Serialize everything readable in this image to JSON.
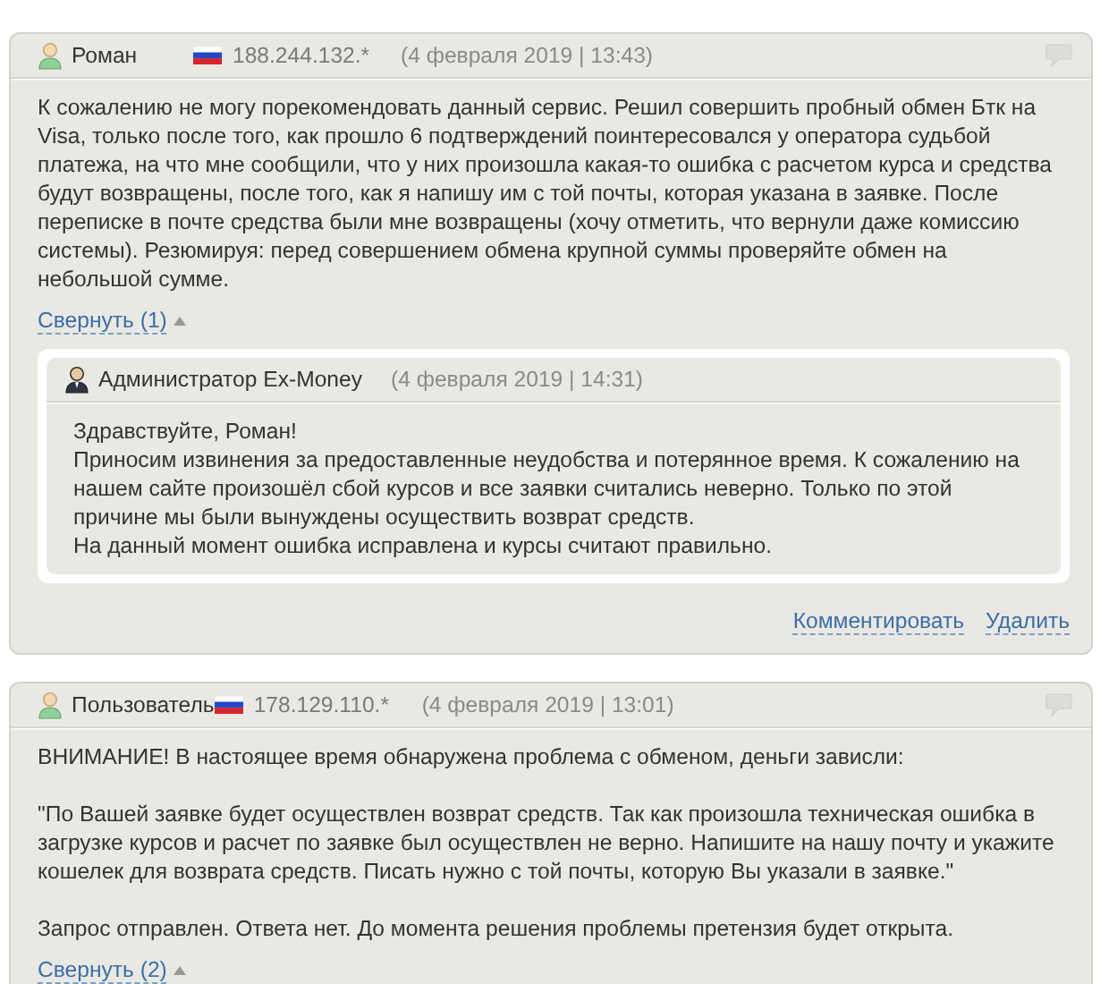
{
  "reviews": [
    {
      "author": "Роман",
      "ip": "188.244.132.*",
      "date": "(4 февраля 2019 | 13:43)",
      "paragraphs": [
        "К сожалению не могу порекомендовать данный сервис. Решил совершить пробный обмен Бтк на Visa, только после того, как прошло 6 подтверждений поинтересовался у оператора судьбой платежа, на что мне сообщили, что у них произошла какая-то ошибка с расчетом курса и средства будут возвращены, после того, как я напишу им с той почты, которая указана в заявке. После переписке в почте средства были мне возвращены (хочу отметить, что вернули даже комиссию системы). Резюмируя: перед совершением обмена крупной суммы проверяйте обмен на небольшой сумме."
      ],
      "collapse": "Свернуть (1)",
      "expanded": true,
      "replies": [
        {
          "author": "Администратор Ex-Money",
          "date": "(4 февраля 2019 | 14:31)",
          "lines": [
            "Здравствуйте, Роман!",
            "Приносим извинения за предоставленные неудобства и потерянное время. К сожалению на нашем сайте произошёл сбой курсов и все заявки считались неверно. Только по этой причине мы были вынуждены осуществить возврат средств.",
            "На данный момент ошибка исправлена и курсы считают правильно."
          ]
        }
      ],
      "actions": [
        "Комментировать",
        "Удалить"
      ]
    },
    {
      "author": "Пользователь",
      "ip": "178.129.110.*",
      "date": "(4 февраля 2019 | 13:01)",
      "paragraphs": [
        "ВНИМАНИЕ! В настоящее время обнаружена проблема с обменом, деньги зависли:",
        "\"По Вашей заявке будет осуществлен возврат средств. Так как произошла техническая ошибка в загрузке курсов и расчет по заявке был осуществлен не верно. Напишите на нашу почту и укажите кошелек для возврата средств. Писать нужно с той почты, которую Вы указали в заявке.\"",
        "Запрос отправлен. Ответа нет. До момента решения проблемы претензия будет открыта."
      ],
      "collapse": "Свернуть (2)",
      "expanded": true
    }
  ]
}
